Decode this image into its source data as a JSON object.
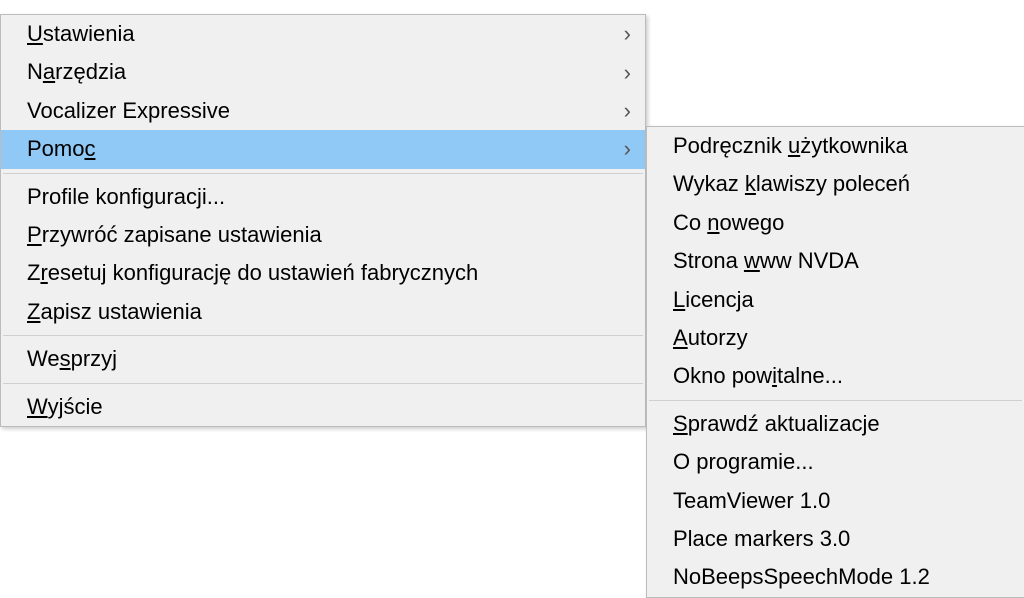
{
  "mainMenu": {
    "items": [
      {
        "label": "Ustawienia",
        "underline": 0,
        "submenu": true
      },
      {
        "label": "Narzędzia",
        "underline": 1,
        "submenu": true
      },
      {
        "label": "Vocalizer Expressive",
        "underline": -1,
        "submenu": true
      },
      {
        "label": "Pomoc",
        "underline": 4,
        "submenu": true,
        "highlighted": true
      },
      {
        "separator": true
      },
      {
        "label": "Profile konfiguracji...",
        "underline": -1
      },
      {
        "label": "Przywróć zapisane ustawienia",
        "underline": 0
      },
      {
        "label": "Zresetuj konfigurację do ustawień fabrycznych",
        "underline": 1
      },
      {
        "label": "Zapisz ustawienia",
        "underline": 0
      },
      {
        "separator": true
      },
      {
        "label": "Wesprzyj",
        "underline": 2
      },
      {
        "separator": true
      },
      {
        "label": "Wyjście",
        "underline": 0
      }
    ]
  },
  "subMenu": {
    "items": [
      {
        "label": "Podręcznik użytkownika",
        "underline": 11
      },
      {
        "label": "Wykaz klawiszy poleceń",
        "underline": 6
      },
      {
        "label": "Co nowego",
        "underline": 3
      },
      {
        "label": "Strona www NVDA",
        "underline": 7
      },
      {
        "label": "Licencja",
        "underline": 0
      },
      {
        "label": "Autorzy",
        "underline": 0
      },
      {
        "label": "Okno powitalne...",
        "underline": 8
      },
      {
        "separator": true
      },
      {
        "label": "Sprawdź aktualizacje",
        "underline": 0
      },
      {
        "label": "O programie...",
        "underline": -1
      },
      {
        "label": "TeamViewer 1.0",
        "underline": -1
      },
      {
        "label": "Place markers 3.0",
        "underline": -1
      },
      {
        "label": "NoBeepsSpeechMode 1.2",
        "underline": -1
      }
    ]
  }
}
